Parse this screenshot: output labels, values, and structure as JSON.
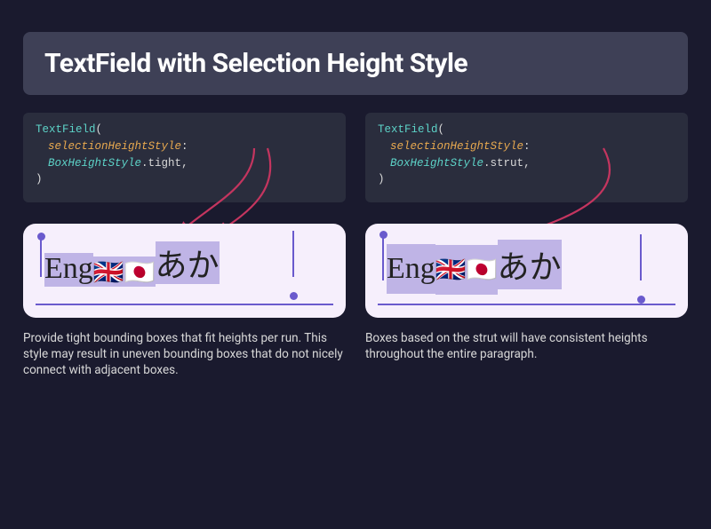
{
  "title": "TextField with Selection Height Style",
  "left": {
    "code": {
      "class": "TextField",
      "param": "selectionHeightStyle",
      "type": "BoxHeightStyle",
      "value": "tight"
    },
    "sample_text": {
      "latin": "Eng",
      "flags": "🇬🇧🇯🇵",
      "jp": "あか"
    },
    "caption": "Provide tight bounding boxes that fit heights per run. This style may result in uneven bounding boxes that do not nicely connect with adjacent boxes."
  },
  "right": {
    "code": {
      "class": "TextField",
      "param": "selectionHeightStyle",
      "type": "BoxHeightStyle",
      "value": "strut"
    },
    "sample_text": {
      "latin": "Eng",
      "flags": "🇬🇧🇯🇵",
      "jp": "あか"
    },
    "caption": "Boxes based on the strut will have consistent heights throughout the entire paragraph."
  }
}
